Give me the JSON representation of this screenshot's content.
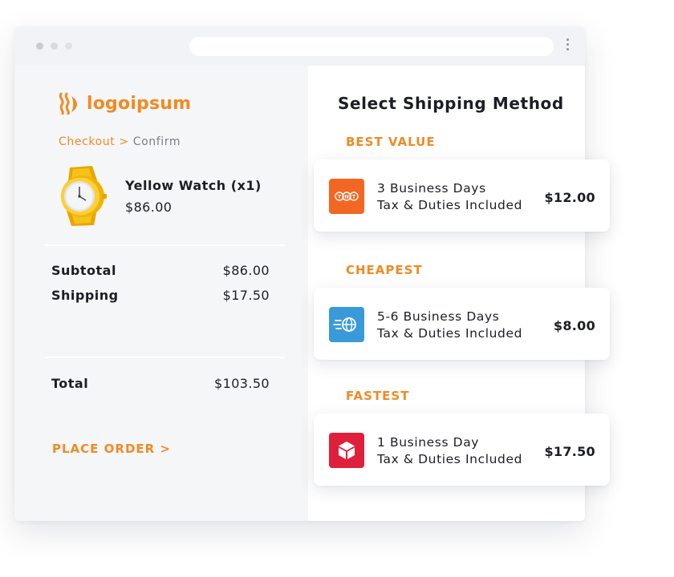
{
  "brand": {
    "name": "logoipsum",
    "accent": "#F28A22"
  },
  "window_icons": [
    "window-dot-red-icon",
    "window-dot-yellow-icon",
    "window-dot-green-icon",
    "kebab-menu-icon"
  ],
  "breadcrumb": {
    "step1": "Checkout",
    "separator": ">",
    "step2": "Confirm"
  },
  "product": {
    "name": "Yellow Watch (x1)",
    "price": "$86.00",
    "icon": "yellow-watch-image"
  },
  "summary": {
    "subtotal_label": "Subtotal",
    "subtotal_value": "$86.00",
    "shipping_label": "Shipping",
    "shipping_value": "$17.50",
    "total_label": "Total",
    "total_value": "$103.50"
  },
  "place_order_label": "PLACE ORDER >",
  "shipping": {
    "title": "Select Shipping Method",
    "options": [
      {
        "tag": "BEST VALUE",
        "line1": "3 Business Days",
        "line2": "Tax & Duties Included",
        "price": "$12.00",
        "icon": "tnt-logo-icon",
        "icon_text": "TNT",
        "color": "#F26722"
      },
      {
        "tag": "CHEAPEST",
        "line1": "5-6 Business Days",
        "line2": "Tax & Duties Included",
        "price": "$8.00",
        "icon": "globe-shipping-icon",
        "color": "#3A9AD9"
      },
      {
        "tag": "FASTEST",
        "line1": "1 Business Day",
        "line2": "Tax & Duties Included",
        "price": "$17.50",
        "icon": "parcel-box-icon",
        "color": "#E01F3D"
      }
    ]
  }
}
